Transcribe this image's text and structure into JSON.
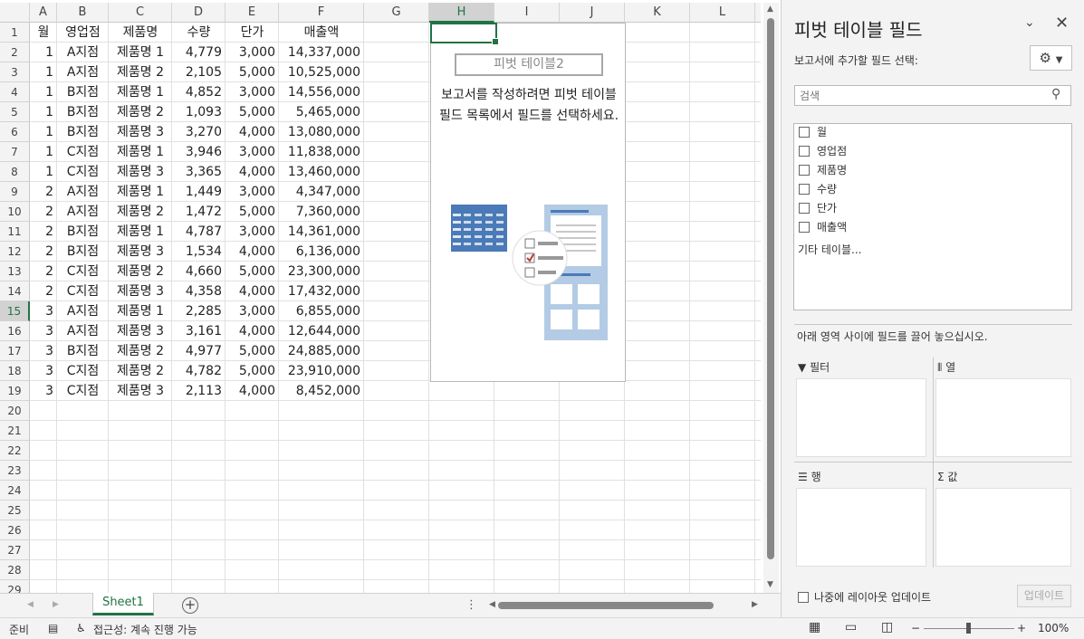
{
  "columns": [
    "A",
    "B",
    "C",
    "D",
    "E",
    "F",
    "G",
    "H",
    "I",
    "J",
    "K",
    "L"
  ],
  "selected_column": "H",
  "rows": [
    "1",
    "2",
    "3",
    "4",
    "5",
    "6",
    "7",
    "8",
    "9",
    "10",
    "11",
    "12",
    "13",
    "14",
    "15",
    "16",
    "17",
    "18",
    "19",
    "20",
    "21",
    "22",
    "23",
    "24",
    "25",
    "26",
    "27",
    "28",
    "29"
  ],
  "selected_row": "15",
  "header_row": [
    "월",
    "영업점",
    "제품명",
    "수량",
    "단가",
    "매출액"
  ],
  "data_rows": [
    [
      "1",
      "A지점",
      "제품명 1",
      "4,779",
      "3,000",
      "14,337,000"
    ],
    [
      "1",
      "A지점",
      "제품명 2",
      "2,105",
      "5,000",
      "10,525,000"
    ],
    [
      "1",
      "B지점",
      "제품명 1",
      "4,852",
      "3,000",
      "14,556,000"
    ],
    [
      "1",
      "B지점",
      "제품명 2",
      "1,093",
      "5,000",
      "5,465,000"
    ],
    [
      "1",
      "B지점",
      "제품명 3",
      "3,270",
      "4,000",
      "13,080,000"
    ],
    [
      "1",
      "C지점",
      "제품명 1",
      "3,946",
      "3,000",
      "11,838,000"
    ],
    [
      "1",
      "C지점",
      "제품명 3",
      "3,365",
      "4,000",
      "13,460,000"
    ],
    [
      "2",
      "A지점",
      "제품명 1",
      "1,449",
      "3,000",
      "4,347,000"
    ],
    [
      "2",
      "A지점",
      "제품명 2",
      "1,472",
      "5,000",
      "7,360,000"
    ],
    [
      "2",
      "B지점",
      "제품명 1",
      "4,787",
      "3,000",
      "14,361,000"
    ],
    [
      "2",
      "B지점",
      "제품명 3",
      "1,534",
      "4,000",
      "6,136,000"
    ],
    [
      "2",
      "C지점",
      "제품명 2",
      "4,660",
      "5,000",
      "23,300,000"
    ],
    [
      "2",
      "C지점",
      "제품명 3",
      "4,358",
      "4,000",
      "17,432,000"
    ],
    [
      "3",
      "A지점",
      "제품명 1",
      "2,285",
      "3,000",
      "6,855,000"
    ],
    [
      "3",
      "A지점",
      "제품명 3",
      "3,161",
      "4,000",
      "12,644,000"
    ],
    [
      "3",
      "B지점",
      "제품명 2",
      "4,977",
      "5,000",
      "24,885,000"
    ],
    [
      "3",
      "C지점",
      "제품명 2",
      "4,782",
      "5,000",
      "23,910,000"
    ],
    [
      "3",
      "C지점",
      "제품명 3",
      "2,113",
      "4,000",
      "8,452,000"
    ]
  ],
  "pivot": {
    "name": "피벗 테이블2",
    "message": "보고서를 작성하려면 피벗 테이블 필드 목록에서 필드를 선택하세요."
  },
  "sheet_tab": "Sheet1",
  "add_sheet": "+",
  "status": {
    "ready": "준비",
    "accessibility": "접근성: 계속 진행 가능",
    "zoom": "100%",
    "zoom_minus": "−",
    "zoom_plus": "+"
  },
  "panel": {
    "title": "피벗 테이블 필드",
    "choose_label": "보고서에 추가할 필드 선택:",
    "search_placeholder": "검색",
    "fields": [
      "월",
      "영업점",
      "제품명",
      "수량",
      "단가",
      "매출액"
    ],
    "more_tables": "기타 테이블...",
    "drag_hint": "아래 영역 사이에 필드를 끌어 놓으십시오.",
    "areas": {
      "filter": "필터",
      "columns": "열",
      "rows": "행",
      "values": "값"
    },
    "defer_label": "나중에 레이아웃 업데이트",
    "update_button": "업데이트"
  }
}
